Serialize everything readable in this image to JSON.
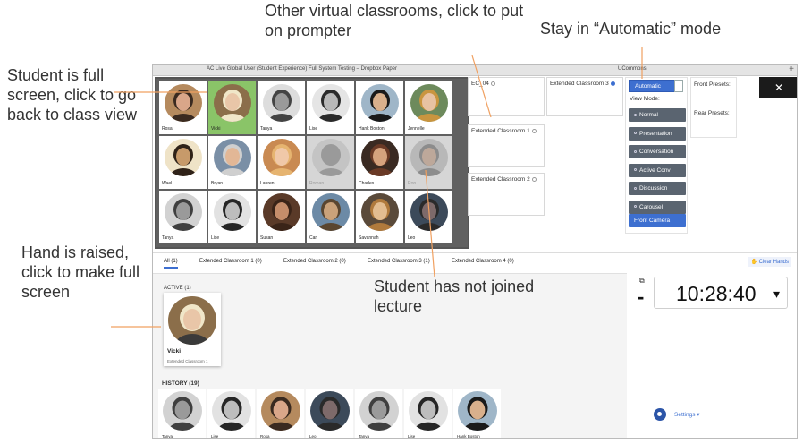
{
  "annotations": {
    "top_middle": "Other virtual classrooms, click to put on prompter",
    "top_right": "Stay in “Automatic” mode",
    "left_top": "Student is full screen, click to go back to class view",
    "left_bottom": "Hand is raised, click to make full screen",
    "middle": "Student has not joined lecture"
  },
  "window": {
    "title": "AC Live Global User (Student Experience) Full System Testing – Dropbox Paper",
    "app_name": "UCommons",
    "plus": "+"
  },
  "grid_students": [
    {
      "name": "Rosa",
      "state": "normal",
      "skin": "#d9a689",
      "hair": "#3a2a20",
      "bg": "#b58a5e"
    },
    {
      "name": "Vicki",
      "state": "selected",
      "skin": "#e9c6a8",
      "hair": "#f0e6c8",
      "bg": "#8b6e4a"
    },
    {
      "name": "Tanya",
      "state": "normal",
      "skin": "#9a9a9a",
      "hair": "#444444",
      "bg": "#dddddd"
    },
    {
      "name": "Lise",
      "state": "normal",
      "skin": "#b8b8b8",
      "hair": "#2b2b2b",
      "bg": "#e5e5e5"
    },
    {
      "name": "Hank Boston",
      "state": "normal",
      "skin": "#d9b08c",
      "hair": "#1a1a1a",
      "bg": "#9fb6c8"
    },
    {
      "name": "Jennelle",
      "state": "normal",
      "skin": "#e8c2a2",
      "hair": "#c9953f",
      "bg": "#6d8a5c"
    },
    {
      "name": "Wael",
      "state": "normal",
      "skin": "#c79a6a",
      "hair": "#2f2218",
      "bg": "#efe3c7"
    },
    {
      "name": "Bryan",
      "state": "normal",
      "skin": "#e2b796",
      "hair": "#cfcfcf",
      "bg": "#7a8fa6"
    },
    {
      "name": "Lauren",
      "state": "normal",
      "skin": "#f0c8a8",
      "hair": "#e6b470",
      "bg": "#c98a52"
    },
    {
      "name": "Roman",
      "state": "offline",
      "skin": "#9a9a9a",
      "hair": "#9a9a9a",
      "bg": "#c4c4c4"
    },
    {
      "name": "Charles",
      "state": "normal",
      "skin": "#d5a27d",
      "hair": "#6a3a26",
      "bg": "#3a2a22"
    },
    {
      "name": "Ron",
      "state": "offline",
      "skin": "#bda89a",
      "hair": "#8c8c8c",
      "bg": "#b8b8b8"
    },
    {
      "name": "Tanya",
      "state": "normal",
      "skin": "#9a9a9a",
      "hair": "#3f3f3f",
      "bg": "#d2d2d2"
    },
    {
      "name": "Lise",
      "state": "normal",
      "skin": "#bdbdbd",
      "hair": "#262626",
      "bg": "#e2e2e2"
    },
    {
      "name": "Susan",
      "state": "normal",
      "skin": "#c58d6a",
      "hair": "#3a2418",
      "bg": "#5a3a28"
    },
    {
      "name": "Carl",
      "state": "normal",
      "skin": "#caa27a",
      "hair": "#5a4630",
      "bg": "#6c8aa6"
    },
    {
      "name": "Savannah",
      "state": "normal",
      "skin": "#e3bd90",
      "hair": "#b07a3c",
      "bg": "#5a4a3a"
    },
    {
      "name": "Leo",
      "state": "normal",
      "skin": "#7e6a6a",
      "hair": "#2a2a2a",
      "bg": "#3c4a5a"
    }
  ],
  "rooms": {
    "ec04": "EC_04",
    "ec3": "Extended Classroom 3",
    "ec1": "Extended Classroom 1",
    "ec2": "Extended Classroom 2"
  },
  "modes": {
    "automatic": "Automatic",
    "view_mode_label": "View Mode:",
    "items": [
      "Normal",
      "Presentation",
      "Conversation",
      "Active Conv",
      "Discussion",
      "Carousel"
    ],
    "front_camera": "Front Camera"
  },
  "presets": {
    "front": "Front Presets:",
    "rear": "Rear Presets:"
  },
  "close_glyph": "✕",
  "tabs": [
    {
      "label": "All (1)",
      "active": true
    },
    {
      "label": "Extended Classroom 1 (0)",
      "active": false
    },
    {
      "label": "Extended Classroom 2 (0)",
      "active": false
    },
    {
      "label": "Extended Classroom 3 (1)",
      "active": false
    },
    {
      "label": "Extended Classroom 4 (0)",
      "active": false
    }
  ],
  "clear_hands": "✋ Clear Hands",
  "active": {
    "label": "ACTIVE (1)",
    "name": "Vicki",
    "room": "Extended Classroom 1"
  },
  "history": {
    "label": "HISTORY (19)",
    "items": [
      {
        "name": "Tanya",
        "skin": "#9a9a9a",
        "hair": "#3f3f3f",
        "bg": "#d2d2d2"
      },
      {
        "name": "Lise",
        "skin": "#bdbdbd",
        "hair": "#262626",
        "bg": "#e2e2e2"
      },
      {
        "name": "Rosa",
        "skin": "#d9a689",
        "hair": "#3a2a20",
        "bg": "#b58a5e"
      },
      {
        "name": "Leo",
        "skin": "#7e6a6a",
        "hair": "#2a2a2a",
        "bg": "#3c4a5a"
      },
      {
        "name": "Tanya",
        "skin": "#9a9a9a",
        "hair": "#3f3f3f",
        "bg": "#d2d2d2"
      },
      {
        "name": "Lise",
        "skin": "#bdbdbd",
        "hair": "#262626",
        "bg": "#e2e2e2"
      },
      {
        "name": "Hank Boston",
        "skin": "#d9b08c",
        "hair": "#1a1a1a",
        "bg": "#9fb6c8"
      }
    ]
  },
  "clock": {
    "time": "10:28:40",
    "chevron": "▾",
    "dash": "-"
  },
  "settings_label": "Settings ▾",
  "colors": {
    "accent": "#3d6fd0",
    "selected_tile": "#8ac468",
    "annotation_arrow": "#f0a060"
  }
}
